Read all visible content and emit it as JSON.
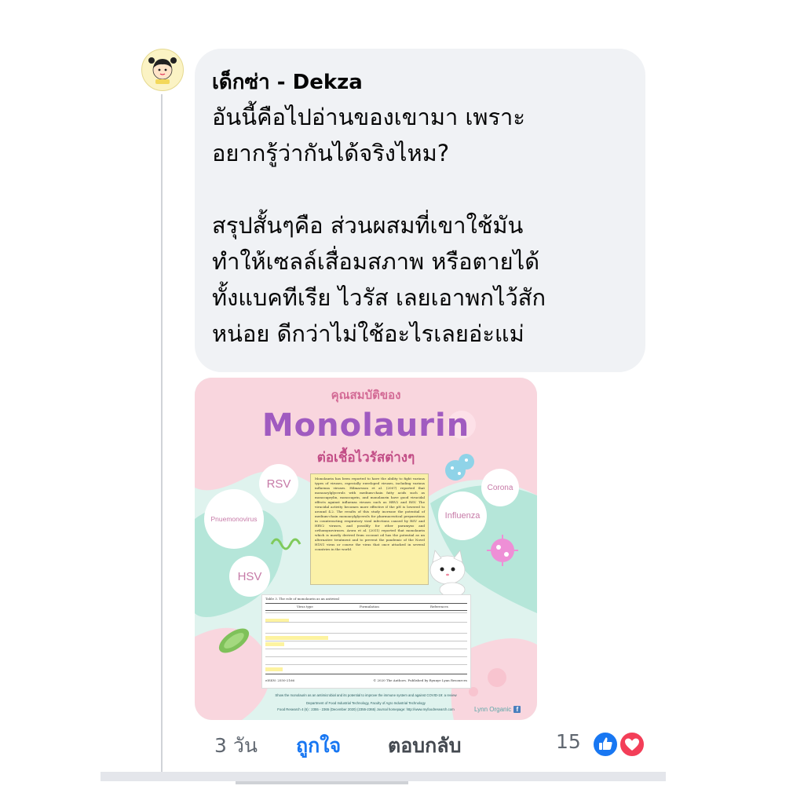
{
  "comment": {
    "author": "เด็กซ่า - Dekza",
    "text": "อันนี้คือไปอ่านของเขามา เพราะ\nอยากรู้ว่ากันได้จริงไหม?\n\nสรุปสั้นๆคือ ส่วนผสมที่เขาใช้มัน\nทำให้เซลล์เสื่อมสภาพ หรือตายได้\nทั้งแบคทีเรีย ไวรัส เลยเอาพกไว้สัก\nหน่อย ดีกว่าไม่ใช้อะไรเลยอ่ะแม่"
  },
  "poster": {
    "kicker": "คุณสมบัติของ",
    "title": "Monolaurin",
    "subtitle": "ต่อเชื้อไวรัสต่างๆ",
    "viruses": [
      "RSV",
      "Pnuemonovirus",
      "HSV",
      "Corona",
      "Influenza"
    ],
    "body": "Monolaurin has been reported to have the ability to fight various types of viruses, especially enveloped viruses, including various influenza viruses. Hilmarsson et al. (2007) reported that monoacylglycerols with medium-chain fatty acids such as monocaprylin, monocaprin, and monolaurin have good virucidal effects against influenza viruses such as HRV2 and RSV. The virucidal activity becomes more effective if the pH is lowered to around 4.2. The results of this study increase the potential of medium-chain monoacylglycerols for pharmaceutical preparations in counteracting respiratory viral infections caused by RSV and HRV2 viruses, and possibly for other paramyxo and orthomyxoviruses. Arora et al. (2011) reported that monolaurin which is mostly derived from coconut oil has the potential as an alternative treatment and to prevent the pandemic of the Novel H1N1 virus or course the virus that once attacked in several countries in the world.",
    "table_caption": "Table 3. The role of monolaurin as an antiviral",
    "table_headers": [
      "Virus type",
      "Formulation",
      "References"
    ],
    "table_footer_left": "eISSN: 2550-2166",
    "table_footer_right": "© 2020 The Authors. Published by Rynnye Lyan Resources",
    "citation_1": "Show the monolaurin as an antimicrobial and its potential to improve the immune system and against COVID-19: a review",
    "citation_2": "Department of Food Industrial Technology, Faculty of Agro Industrial Technology",
    "citation_3": "Food Research 4 (6) : 2355 - 2365 (December 2020) (2355-2365) Journal homepage: http://www.myfoodresearch.com",
    "brand": "Lynn Organic"
  },
  "actions": {
    "time": "3 วัน",
    "like": "ถูกใจ",
    "reply": "ตอบกลับ"
  },
  "reactions": {
    "count": "15"
  },
  "colors": {
    "like_blue": "#1877f2",
    "love_red": "#f33e58",
    "bubble": "#f0f2f5",
    "poster_pink": "#f9d6de",
    "poster_mint": "#b5e6d9",
    "title_purple": "#a05bc0"
  },
  "icons": [
    "like-reaction-icon",
    "love-reaction-icon",
    "facebook-icon"
  ]
}
